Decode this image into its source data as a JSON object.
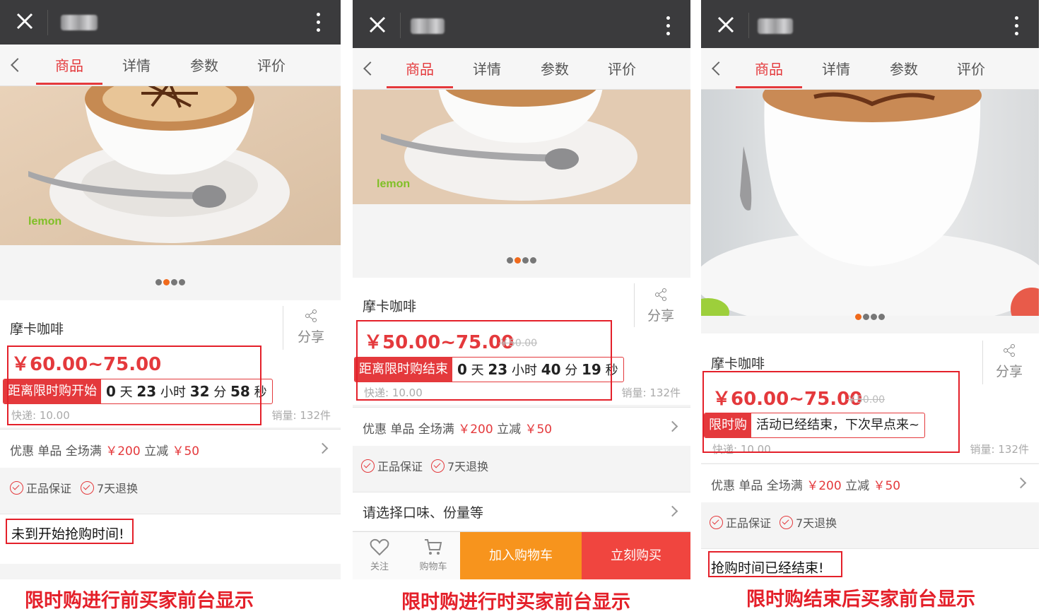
{
  "panels": [
    {
      "tabs": [
        "商品",
        "详情",
        "参数",
        "评价"
      ],
      "product_title": "摩卡咖啡",
      "share_label": "分享",
      "price": "￥60.00~75.00",
      "countdown_label": "距离限时购开始",
      "countdown": {
        "d": "0",
        "d_unit": "天",
        "h": "23",
        "h_unit": "小时",
        "m": "32",
        "m_unit": "分",
        "s": "58",
        "s_unit": "秒"
      },
      "shipping": "快递: 10.00",
      "sales": "销量: 132件",
      "promo": {
        "prefix": "优惠 单品 全场满 ",
        "amount1": "￥200",
        "mid": " 立减 ",
        "amount2": "￥50"
      },
      "guarantees": [
        "正品保证",
        "7天退换"
      ],
      "status_note": "未到开始抢购时间!",
      "caption": "限时购进行前买家前台显示",
      "carousel_active": 1
    },
    {
      "tabs": [
        "商品",
        "详情",
        "参数",
        "评价"
      ],
      "product_title": "摩卡咖啡",
      "share_label": "分享",
      "price": "￥50.00~75.00",
      "old_price": "￥50.00",
      "countdown_label": "距离限时购结束",
      "countdown": {
        "d": "0",
        "d_unit": "天",
        "h": "23",
        "h_unit": "小时",
        "m": "40",
        "m_unit": "分",
        "s": "19",
        "s_unit": "秒"
      },
      "shipping": "快递: 10.00",
      "sales": "销量: 132件",
      "promo": {
        "prefix": "优惠 单品 全场满 ",
        "amount1": "￥200",
        "mid": " 立减 ",
        "amount2": "￥50"
      },
      "guarantees": [
        "正品保证",
        "7天退换"
      ],
      "option_row": "请选择口味、份量等",
      "bottom": {
        "follow": "关注",
        "cart": "购物车",
        "add_to_cart": "加入购物车",
        "buy_now": "立刻购买"
      },
      "caption": "限时购进行时买家前台显示",
      "carousel_active": 1
    },
    {
      "tabs": [
        "商品",
        "详情",
        "参数",
        "评价"
      ],
      "product_title": "摩卡咖啡",
      "share_label": "分享",
      "price": "￥60.00~75.00",
      "old_price": "￥50.00",
      "ended_label": "限时购",
      "ended_text": "活动已经结束，下次早点来~",
      "shipping": "快递: 10.00",
      "sales": "销量: 132件",
      "promo": {
        "prefix": "优惠 单品 全场满 ",
        "amount1": "￥200",
        "mid": " 立减 ",
        "amount2": "￥50"
      },
      "guarantees": [
        "正品保证",
        "7天退换"
      ],
      "status_note": "抢购时间已经结束!",
      "caption": "限时购结束后买家前台显示",
      "carousel_active": 0
    }
  ],
  "colors": {
    "accent": "#e4393c",
    "highlight_box": "#e4202a",
    "topbar": "#3b3b3d",
    "add_to_cart": "#f7941d",
    "buy_now": "#f0453f"
  },
  "icons": [
    "close-icon",
    "more-icon",
    "back-chevron-icon",
    "share-icon",
    "check-circle-icon",
    "heart-icon",
    "cart-icon",
    "chevron-right-icon"
  ]
}
